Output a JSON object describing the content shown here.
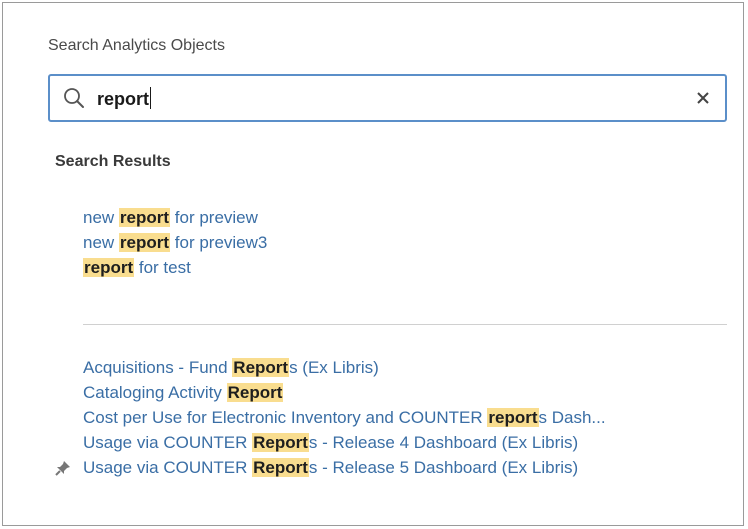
{
  "search": {
    "label": "Search Analytics Objects",
    "value": "report",
    "clear_glyph": "×"
  },
  "results": {
    "heading": "Search Results",
    "group1": [
      {
        "pre": "new ",
        "hl": "report",
        "post": " for preview"
      },
      {
        "pre": "new ",
        "hl": "report",
        "post": " for preview3"
      },
      {
        "pre": "",
        "hl": "report",
        "post": " for test"
      }
    ],
    "group2": [
      {
        "pre": "Acquisitions - Fund ",
        "hl": "Report",
        "post": "s (Ex Libris)"
      },
      {
        "pre": "Cataloging Activity ",
        "hl": "Report",
        "post": ""
      },
      {
        "pre": "Cost per Use for Electronic Inventory and COUNTER ",
        "hl": "report",
        "post": "s Dash..."
      },
      {
        "pre": "Usage via COUNTER ",
        "hl": "Report",
        "post": "s - Release 4 Dashboard (Ex Libris)"
      },
      {
        "pre": "Usage via COUNTER ",
        "hl": "Report",
        "post": "s - Release 5 Dashboard (Ex Libris)",
        "pinned": true
      }
    ]
  },
  "colors": {
    "link": "#3a6ea5",
    "highlight": "#f9dd8f",
    "focus_border": "#5b8fc9"
  },
  "icons": {
    "search": "search-icon",
    "clear": "close-icon",
    "pin": "pin-icon"
  }
}
